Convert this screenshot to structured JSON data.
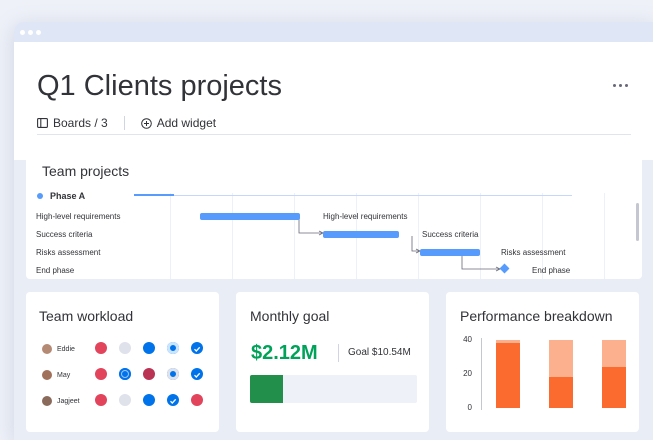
{
  "window": {
    "controls": [
      "dot",
      "dot",
      "dot"
    ]
  },
  "header": {
    "title": "Q1 Clients projects",
    "boards_label": "Boards / 3",
    "add_widget_label": "Add widget"
  },
  "team_projects": {
    "title": "Team projects",
    "phase_label": "Phase A",
    "rows": [
      {
        "label": "High-level requirements",
        "bar_label": "High-level requirements"
      },
      {
        "label": "Success criteria",
        "bar_label": "Success criteria"
      },
      {
        "label": "Risks assessment",
        "bar_label": "Risks assessment"
      },
      {
        "label": "End phase",
        "bar_label": "End phase"
      }
    ]
  },
  "team_workload": {
    "title": "Team workload",
    "people": [
      {
        "name": "Eddie"
      },
      {
        "name": "May"
      },
      {
        "name": "Jagjeet"
      }
    ]
  },
  "monthly_goal": {
    "title": "Monthly goal",
    "amount": "$2.12M",
    "goal_label": "Goal $10.54M",
    "progress": 0.2
  },
  "performance_breakdown": {
    "title": "Performance breakdown",
    "colors": {
      "primary": "#fb6a2f",
      "secondary": "#fdb08d"
    }
  },
  "chart_data": {
    "type": "bar",
    "stacked": true,
    "categories": [
      "",
      "",
      ""
    ],
    "series": [
      {
        "values": [
          38,
          18,
          24
        ]
      },
      {
        "values": [
          2,
          22,
          16
        ]
      }
    ],
    "y_ticks": [
      "40",
      "20",
      "0"
    ],
    "ylim": [
      0,
      40
    ],
    "title": "Performance breakdown",
    "xlabel": "",
    "ylabel": ""
  }
}
